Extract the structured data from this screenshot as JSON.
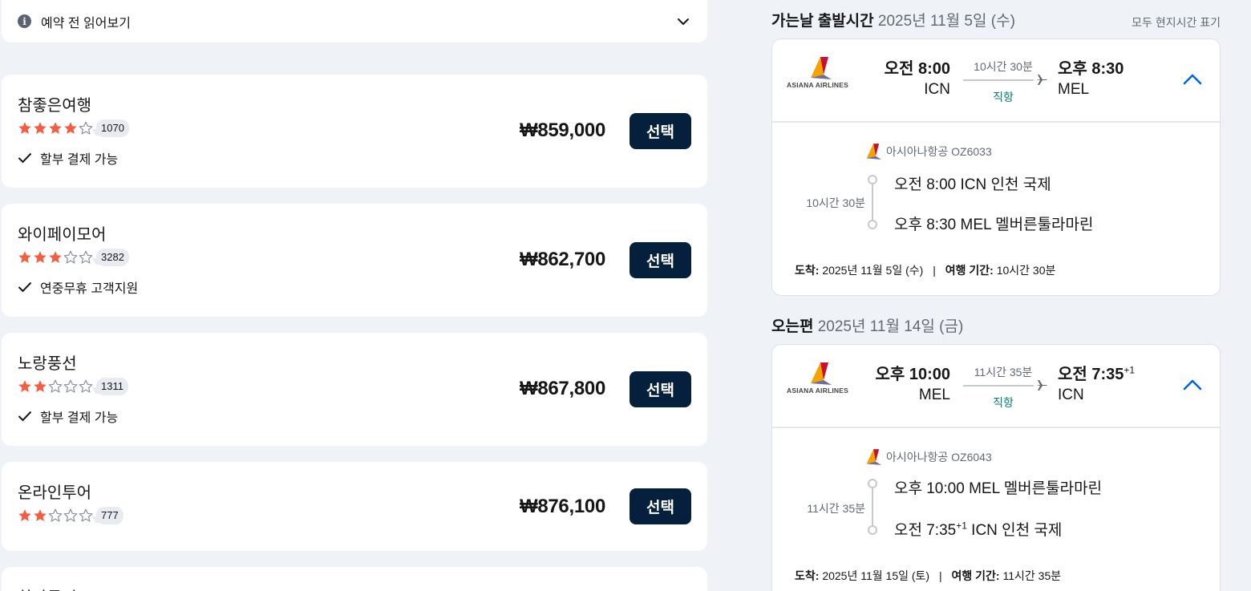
{
  "notice": {
    "label": "예약 전 읽어보기"
  },
  "agencies": [
    {
      "name": "참좋은여행",
      "stars": 4,
      "reviews": "1070",
      "feature": "할부 결제 가능",
      "price": "₩859,000",
      "button": "선택"
    },
    {
      "name": "와이페이모어",
      "stars": 3,
      "reviews": "3282",
      "feature": "연중무휴 고객지원",
      "price": "₩862,700",
      "button": "선택"
    },
    {
      "name": "노랑풍선",
      "stars": 2,
      "reviews": "1311",
      "feature": "할부 결제 가능",
      "price": "₩867,800",
      "button": "선택"
    },
    {
      "name": "온라인투어",
      "stars": 2,
      "reviews": "777",
      "feature": "",
      "price": "₩876,100",
      "button": "선택"
    },
    {
      "name": "하나투어",
      "stars": 0,
      "reviews": "",
      "feature": "",
      "price": "",
      "button": ""
    }
  ],
  "outbound": {
    "title_bold": "가는날 출발시간",
    "title_date": "2025년 11월 5일 (수)",
    "local_time_note": "모두 현지시간 표기",
    "logo_text": "ASIANA AIRLINES",
    "dep_time": "오전 8:00",
    "dep_code": "ICN",
    "duration": "10시간 30분",
    "direct": "직항",
    "arr_time": "오후 8:30",
    "arr_code": "MEL",
    "segment_airline": "아시아나항공 OZ6033",
    "segment_duration": "10시간 30분",
    "stop1": "오전 8:00 ICN 인천 국제",
    "stop2": "오후 8:30 MEL 멜버른툴라마린",
    "arrival_label": "도착:",
    "arrival_value": "2025년 11월 5일 (수)",
    "sep": "|",
    "trip_label": "여행 기간:",
    "trip_value": "10시간 30분"
  },
  "inbound": {
    "title_bold": "오는편",
    "title_date": "2025년 11월 14일 (금)",
    "logo_text": "ASIANA AIRLINES",
    "dep_time": "오후 10:00",
    "dep_code": "MEL",
    "duration": "11시간 35분",
    "direct": "직항",
    "arr_time": "오전 7:35",
    "arr_sup": "+1",
    "arr_code": "ICN",
    "segment_airline": "아시아나항공 OZ6043",
    "segment_duration": "11시간 35분",
    "stop1": "오후 10:00 MEL 멜버른툴라마린",
    "stop2_time": "오전 7:35",
    "stop2_sup": "+1",
    "stop2_rest": " ICN 인천 국제",
    "arrival_label": "도착:",
    "arrival_value": "2025년 11월 15일 (토)",
    "sep": "|",
    "trip_label": "여행 기간:",
    "trip_value": "11시간 35분"
  },
  "colors": {
    "star": "#f55d42",
    "button": "#05203c",
    "direct": "#007a73",
    "accent": "#0062e3"
  },
  "icons": [
    "info-icon",
    "chevron-down-icon",
    "star-icon",
    "checkmark-icon",
    "plane-icon",
    "chevron-up-icon",
    "asiana-logo"
  ]
}
